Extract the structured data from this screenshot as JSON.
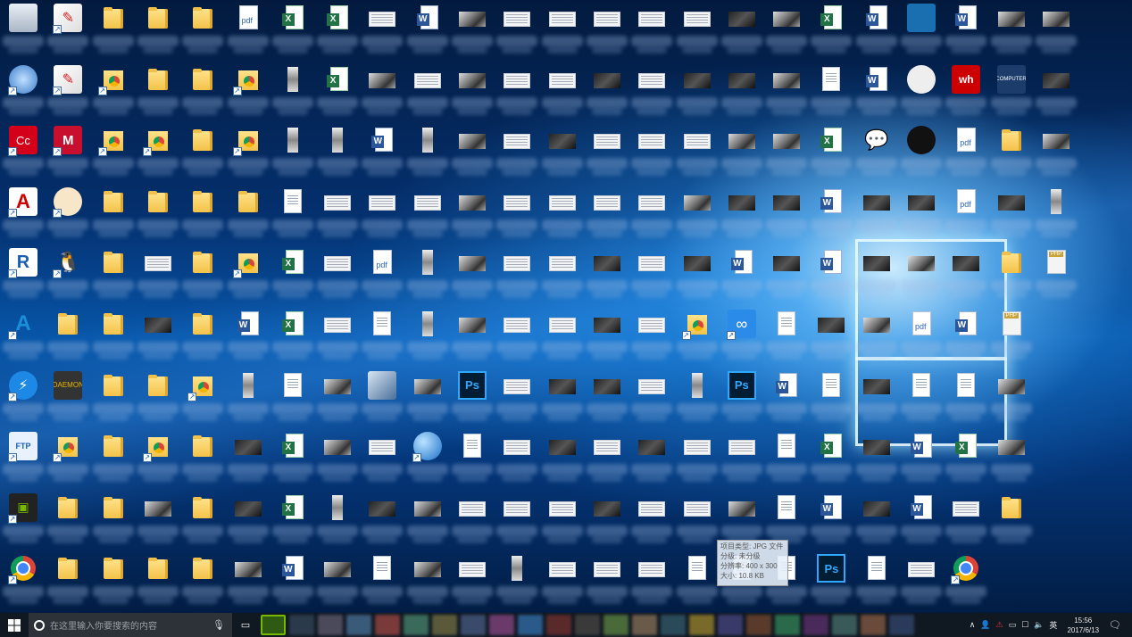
{
  "desktop": {
    "tooltip": {
      "lines": [
        "项目类型: JPG 文件",
        "分级: 未分级",
        "分辨率: 400 x 300",
        "大小: 10.8 KB"
      ]
    },
    "columns": 24,
    "icons": [
      [
        "recycle",
        "acrobat",
        "folder",
        "folder",
        "folder",
        "pdf",
        "excel",
        "excel",
        "thumbw",
        "word",
        "thumb",
        "thumbw",
        "thumbw",
        "thumbw",
        "thumbw",
        "thumbw",
        "thumbd",
        "thumb",
        "excel",
        "word",
        "app-blue",
        "word",
        "thumb",
        "thumb"
      ],
      [
        "app-3d",
        "acrobat",
        "chromef",
        "folder",
        "folder",
        "chromef",
        "tall",
        "excel",
        "thumb",
        "thumbw",
        "thumb",
        "thumbw",
        "thumbw",
        "thumbd",
        "thumbw",
        "thumbd",
        "thumbd",
        "thumb",
        "doc",
        "word",
        "app-round",
        "app-wh",
        "app-comp",
        "thumbd"
      ],
      [
        "app-cc",
        "app-mcafee",
        "chromef",
        "chromef",
        "folder",
        "chromef",
        "tall",
        "tall",
        "word",
        "tall",
        "thumb",
        "thumbw",
        "thumbd",
        "thumbw",
        "thumbw",
        "thumbw",
        "thumb",
        "thumb",
        "excel",
        "app-wechat",
        "app-ball",
        "pdf",
        "folder",
        "thumb"
      ],
      [
        "app-autocad",
        "app-paint",
        "folder",
        "folder",
        "folder",
        "folder",
        "doc",
        "thumbw",
        "thumbw",
        "thumbw",
        "thumb",
        "thumbw",
        "thumbw",
        "thumbw",
        "thumbw",
        "thumb",
        "thumbd",
        "thumbd",
        "word",
        "thumbd",
        "thumbd",
        "pdf",
        "thumbd",
        "tall"
      ],
      [
        "app-revit",
        "app-qq",
        "folder",
        "thumbw",
        "folder",
        "chromef",
        "excel",
        "thumbw",
        "pdf",
        "tall",
        "thumb",
        "thumbw",
        "thumbw",
        "thumbd",
        "thumbw",
        "thumbd",
        "word",
        "thumbd",
        "word",
        "thumbd",
        "thumb",
        "thumbd",
        "folder",
        "php"
      ],
      [
        "app-autodesk",
        "folder",
        "folder",
        "thumbd",
        "folder",
        "word",
        "excel",
        "thumbw",
        "doc",
        "tall",
        "thumb",
        "thumbw",
        "thumbw",
        "thumbd",
        "thumbw",
        "chromef",
        "app-baidu",
        "doc",
        "thumbd",
        "thumb",
        "pdf",
        "word",
        "php",
        "none"
      ],
      [
        "app-ie",
        "app-daemon",
        "folder",
        "folder",
        "chromef",
        "tall",
        "doc",
        "thumb",
        "app-corel",
        "thumb",
        "psd",
        "thumbw",
        "thumbd",
        "thumbd",
        "thumbw",
        "tall",
        "psd",
        "word",
        "doc",
        "thumbd",
        "doc",
        "doc",
        "thumb",
        "none"
      ],
      [
        "app-ftp",
        "chromef",
        "folder",
        "chromef",
        "folder",
        "thumbd",
        "excel",
        "thumb",
        "thumbw",
        "app-globe",
        "doc",
        "thumbw",
        "thumbd",
        "thumbw",
        "thumbd",
        "thumbw",
        "thumbw",
        "doc",
        "excel",
        "thumbd",
        "word",
        "excel",
        "thumb",
        "none"
      ],
      [
        "app-nvidia",
        "folder",
        "folder",
        "thumb",
        "folder",
        "thumbd",
        "excel",
        "tall",
        "thumbd",
        "thumb",
        "thumbw",
        "thumbw",
        "thumbw",
        "thumbd",
        "thumbw",
        "thumbw",
        "thumb",
        "doc",
        "word",
        "thumbd",
        "word",
        "thumbw",
        "folder",
        "none"
      ],
      [
        "chrome",
        "folder",
        "folder",
        "folder",
        "folder",
        "thumb",
        "word",
        "thumb",
        "doc",
        "thumb",
        "thumbw",
        "tall",
        "thumbw",
        "thumbw",
        "thumbw",
        "doc",
        "doc",
        "doc",
        "psd",
        "doc",
        "thumbw",
        "chrome",
        "none",
        "none"
      ]
    ]
  },
  "taskbar": {
    "search_placeholder": "在这里输入你要搜索的内容",
    "time": "15:56",
    "date": "2017/6/13"
  }
}
